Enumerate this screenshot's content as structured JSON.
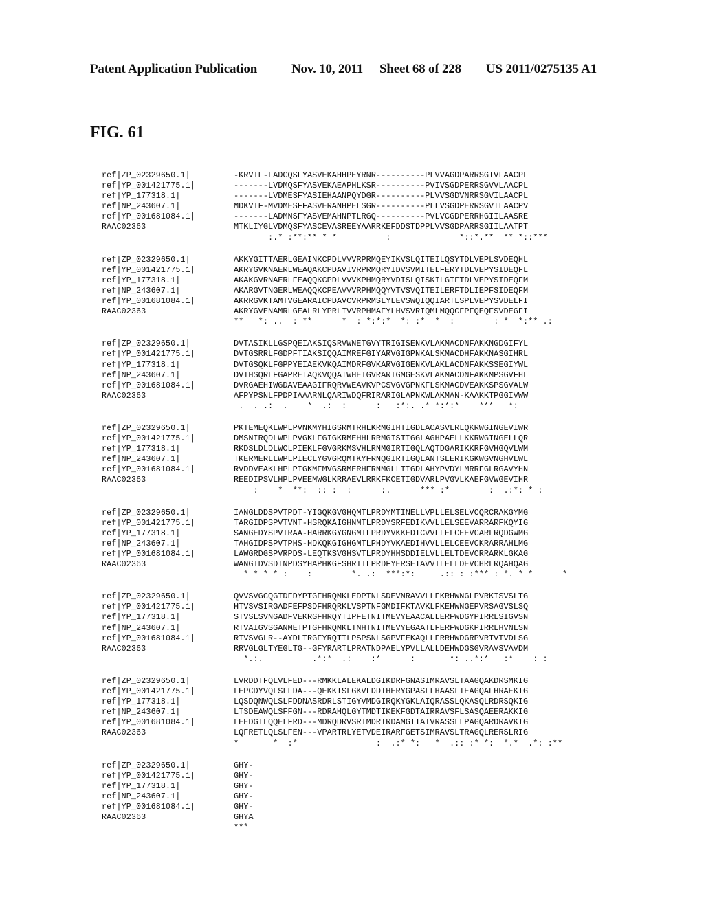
{
  "header": {
    "publication": "Patent Application Publication",
    "date": "Nov. 10, 2011",
    "sheet": "Sheet 68 of 228",
    "number": "US 2011/0275135 A1"
  },
  "figure_label": "FIG. 61",
  "sequence_ids": [
    "ref|ZP_02329650.1|",
    "ref|YP_001421775.1|",
    "ref|YP_177318.1|",
    "ref|NP_243607.1|",
    "ref|YP_001681084.1|",
    "RAAC02363"
  ],
  "blocks": [
    {
      "sequences": [
        "-KRVIF-LADCQSFYASVEKAHHPEYRNR----------PLVVAGDPARRSGIVLAACPL",
        "-------LVDMQSFYASVEKAEAPHLKSR----------PVIVSGDPERRSGVVLAACPL",
        "-------LVDMESFYASIEHAANPQYDGR----------PLVVSGDVNRRSGVILAACPL",
        "MDKVIF-MVDMESFFASVERANHPELSGR----------PLLVSGDPERRSGVILAACPV",
        "-------LADMNSFYASVEMAHNPTLRGQ----------PVLVCGDPERRHGIILAASRE",
        "MTKLIYGLVDMQSFYASCEVASREEYAARRKEFDDSTDPPLVVSGDPARRSGIILAATPT"
      ],
      "consensus": "       :.* :**:** * *          :              *::*.**  ** *::***"
    },
    {
      "sequences": [
        "AKKYGITTAERLGEAINKCPDLVVVRPRMQEYIKVSLQITEILQSYTDLVEPLSVDEQHL",
        "AKRYGVKNAERLWEAQAKCPDAVIVRPRMQRYIDVSVMITELFERYTDLVEPYSIDEQFL",
        "AKAKGVRNAERLFEAQQKCPDLVVVKPHMQRYVDISLQISKILGTFTDLVEPYSIDEQFM",
        "AKARGVTNGERLWEAQQKCPEAVVVRPHMQQYVTVSVQITEILERFTDLIEPFSIDEQFM",
        "AKRRGVKTAMTVGEARAICPDAVCVRPRMSLYLEVSWQIQQIARTLSPLVEPYSVDELFI",
        "AKRYGVENAMRLGEALRLYPRLIVVRPHMAFYLHVSVRIQMLMQQCFPFQEQFSVDEGFI"
      ],
      "consensus": "**   *: ..  : **      *  : *:*:*  *: :*  *  :        : *  *:** .:"
    },
    {
      "sequences": [
        "DVTASIKLLGSPQEIAKSIQSRVWNETGVYTRIGISENKVLAKMACDNFAKKNGDGIFYL",
        "DVTGSRRLFGDPFTIAKSIQQAIMREFGIYARVGIGPNKALSKMACDHFAKKNASGIHRL",
        "DVTGSQKLFGPPYEIAEKVKQAIMDRFGVKARVGIGENKVLAKLACDNFAKKSSEGIYWL",
        "DVTHSQRLFGAPREIAQKVQQAIWHETGVRARIGMGESKVLAKMACDNFAKKMPSGVFHL",
        "DVRGAEHIWGDAVEAAGIFRQRVWEAVKVPCSVGVGPNKFLSKMACDVEAKKSPSGVALW",
        "AFPYPSNLFPDPIAAARNLQARIWDQFRIRARIGLAPNKWLAKMAN-KAAKKTPGGIVWW"
      ],
      "consensus": " .  . .:  .    *  .:  :      :   :*:. .* *:*:*    ***   *:"
    },
    {
      "sequences": [
        "PKTEMEQKLWPLPVNKMYHIGSRMTRHLKRMGIHTIGDLACASVLRLQKRWGINGEVIWR",
        "DMSNIRQDLWPLPVGKLFGIGKRMEHHLRRMGISTIGGLAGHPAELLKKRWGINGELLQR",
        "RKDSLDLDLWCLPIEKLFGVGRKMSVHLRNMGIRTIGQLAQTDGARIKKRFGVHGQVLWM",
        "TKERMERLLWPLPIECLYGVGRQMTKYFRNQGIRTIGQLANTSLERIKGKWGVNGHVLWL",
        "RVDDVEAKLHPLPIGKMFMVGSRMERHFRNMGLLTIGDLAHYPVDYLMRRFGLRGAVYHN",
        "REEDIPSVLHPLPVEEMWGLKRRAEVLRRKFKCETIGDVARLPVGVLKAEFGVWGEVIHR"
      ],
      "consensus": "    :    *  **:  :: :  :      :.      *** :*        :  .:*: * :"
    },
    {
      "sequences": [
        "IANGLDDSPVTPDT-YIGQKGVGHQMTLPRDYMTINELLVPLLELSELVCQRCRAKGYMG",
        "TARGIDPSPVTVNT-HSRQKAIGHNMTLPRDYSRFEDIKVVLLELSEEVARRARFKQYIG",
        "SANGEDYSPVTRAA-HARRKGYGNGMTLPRDYVKKEDICVVLLELCEEVCARLRQDGWMG",
        "TAHGIDPSPVTPHS-HDKQKGIGHGMTLPHDYVKAEDIHVVLLELCEEVCKRARRAHLMG",
        "LAWGRDGSPVRPDS-LEQTKSVGHSVTLPRDYHHSDDIELVLLELTDEVCRRARKLGKAG",
        "WANGIDVSDINPDSYHAPHKGFSHRTTLPRDFYERSEIAVVILELLDEVCHRLRQAHQAG"
      ],
      "consensus": "  * * * * :    :        *. .:  ***:*:     .:: : :*** : *. * *      *"
    },
    {
      "sequences": [
        "QVVSVGCQGTDFDYPTGFHRQMKLEDPTNLSDEVNRAVVLLFKRHWNGLPVRKISVSLTG",
        "HTVSVSIRGADFEFPSDFHRQRKLVSPTNFGMDIFKTAVKLFKEHWNGEPVRSAGVSLSQ",
        "STVSLSVNGADFVEKRGFHRQYTIPFETNITMEVYEAACALLERFWDGYPIRRLSIGVSN",
        "RTVAIGVSGANMETPTGFHRQMKLTNHTNITMEVYEGAATLFERFWDGKPIRRLHVNLSN",
        "RTVSVGLR--AYDLTRGFYRQTTLPSPSNLSGPVFEKAQLLFRRHWDGRPVRTVTVDLSG",
        "RRVGLGLTYEGLTG--GFYRARTLPRATNDPAELYPVLLALLDEHWDGSGVRAVSVAVDM"
      ],
      "consensus": "  *.:.          .*:*  .:    :*      :       *: ..*:*   :*    : :"
    },
    {
      "sequences": [
        "LVRDDTFQLVLFED---RMKKLALEKALDGIKDRFGNASIMRAVSLTAAGQAKDRSMKIG",
        "LEPCDYVQLSLFDA---QEKKISLGKVLDDIHERYGPASLLHAASLTEAGQAFHRAEKIG",
        "LQSDQNWQLSLFDDNASRDRLSTIGYVMDGIRQKYGKLAIQRASSLQKASQLRDRSQKIG",
        "LTSDEAWQLSFFGN---RDRAHQLGYTMDTIKEKFGDTAIRRAVSFLSASQAEERAKKIG",
        "LEEDGTLQQELFRD---MDRQDRVSRTMDRIRDAMGTTAIVRASSLLPAGQARDRAVKIG",
        "LQFRETLQLSLFEN---VPARTRLYETVDEIRARFGETSIMRAVSLTRAGQLRERSLRIG"
      ],
      "consensus": "*       *  :*                :  .:* *:   *  .:: :* *:  *.*  .*: :**"
    },
    {
      "sequences": [
        "GHY-",
        "GHY-",
        "GHY-",
        "GHY-",
        "GHY-",
        "GHYA"
      ],
      "consensus": "***"
    }
  ]
}
